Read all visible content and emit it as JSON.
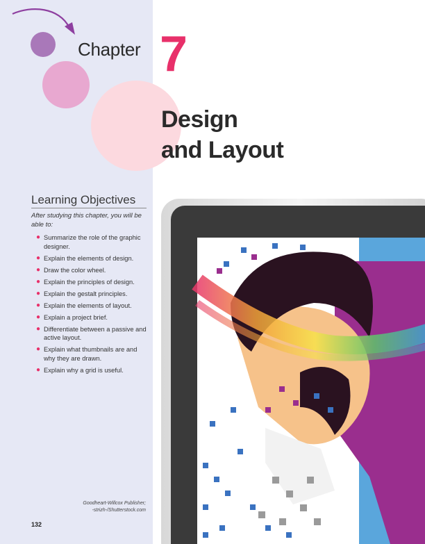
{
  "chapter": {
    "word": "Chapter",
    "number": "7",
    "title_line1": "Design",
    "title_line2": "and Layout"
  },
  "objectives": {
    "heading": "Learning Objectives",
    "intro": "After studying this chapter, you will be able to:",
    "items": [
      "Summarize the role of the graphic designer.",
      "Explain the elements of design.",
      "Draw the color wheel.",
      "Explain the principles of design.",
      "Explain the gestalt principles.",
      "Explain the elements of layout.",
      "Explain a project brief.",
      "Differentiate between a passive and active layout.",
      "Explain what thumbnails are and why they are drawn.",
      "Explain why a grid is useful."
    ]
  },
  "credit": {
    "line1": "Goodheart-Willcox Publisher;",
    "line2": "-strizh-/Shutterstock.com"
  },
  "page_number": "132",
  "colors": {
    "sidebar_bg": "#e6e8f5",
    "accent_pink": "#e8306a",
    "circle_purple": "#a978b9",
    "circle_pink": "#e8a8d0",
    "circle_light": "#fcd9df"
  }
}
